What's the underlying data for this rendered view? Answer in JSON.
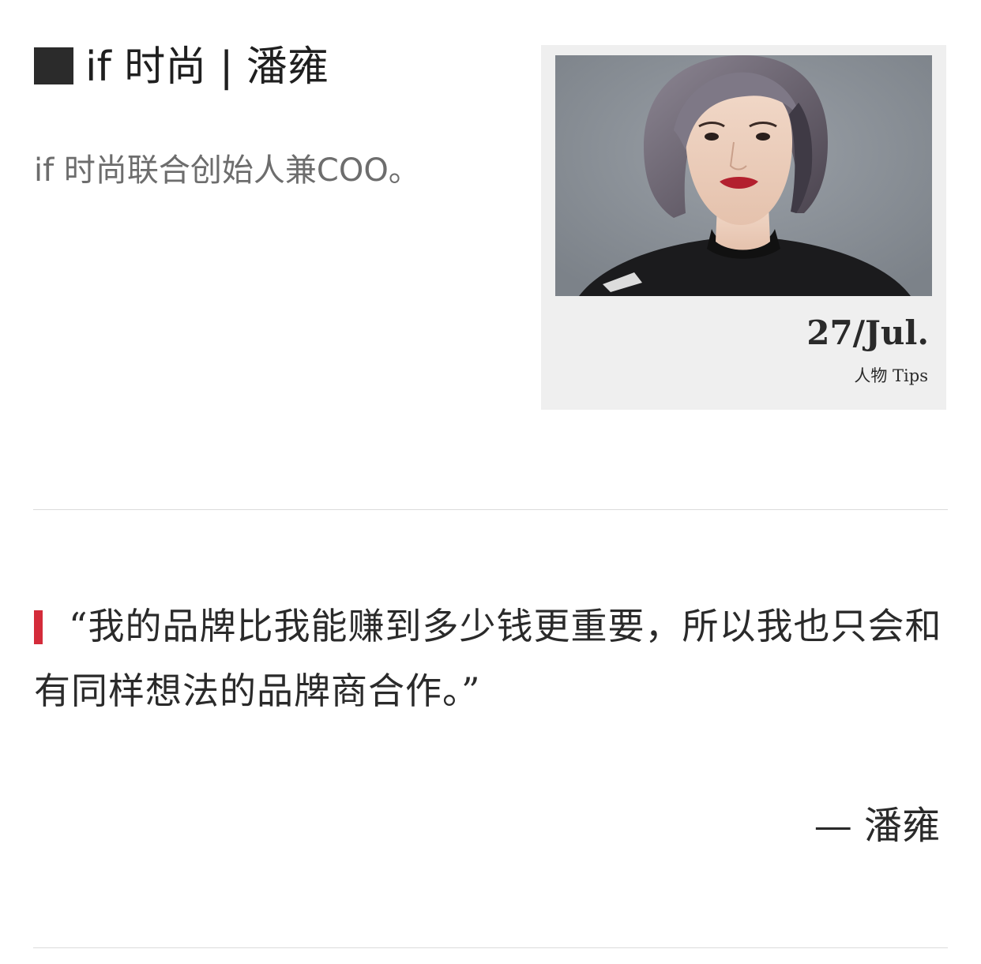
{
  "header": {
    "title": "if 时尚 | 潘雍"
  },
  "subtitle": "if 时尚联合创始人兼COO。",
  "card": {
    "date": "27/Jul.",
    "tag": "人物 Tips"
  },
  "quote": {
    "text": "“我的品牌比我能赚到多少钱更重要，所以我也只会和有同样想法的品牌商合作。”",
    "attribution": "— 潘雍"
  },
  "colors": {
    "accent": "#d42b3a",
    "card_background": "#efefef",
    "header_square": "#2b2b2b",
    "photo_background": "#8a8f96"
  },
  "icons": {
    "header_marker": "square-marker-icon",
    "quote_marker": "quote-bar-icon"
  }
}
